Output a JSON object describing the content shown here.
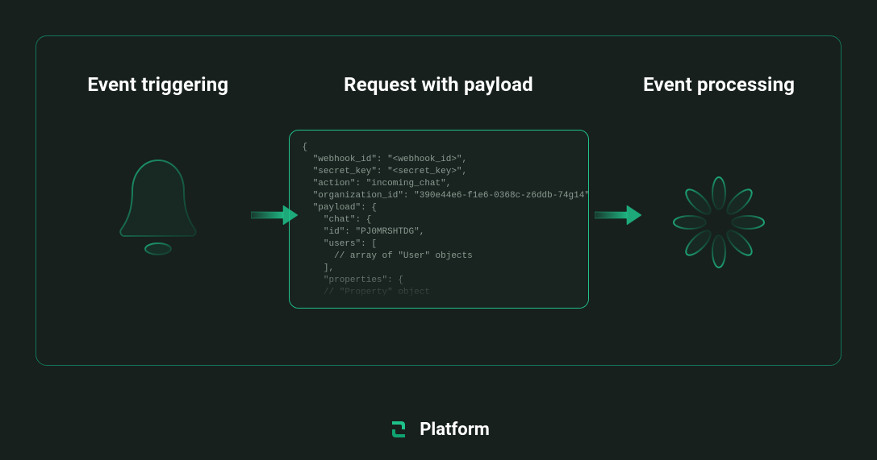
{
  "columns": {
    "left": {
      "title": "Event triggering"
    },
    "mid": {
      "title": "Request with payload"
    },
    "right": {
      "title": "Event processing"
    }
  },
  "code_lines": [
    "{",
    "  \"webhook_id\": \"<webhook_id>\",",
    "  \"secret_key\": \"<secret_key>\",",
    "  \"action\": \"incoming_chat\",",
    "  \"organization_id\": \"390e44e6-f1e6-0368c-z6ddb-74g14\",",
    "  \"payload\": {",
    "    \"chat\": {",
    "    \"id\": \"PJ0MRSHTDG\",",
    "    \"users\": [",
    "      // array of \"User\" objects",
    "    ],",
    "    \"properties\": {",
    "    // \"Property\" object"
  ],
  "footer": {
    "brand": "Platform"
  },
  "colors": {
    "accent": "#1fc28b"
  }
}
